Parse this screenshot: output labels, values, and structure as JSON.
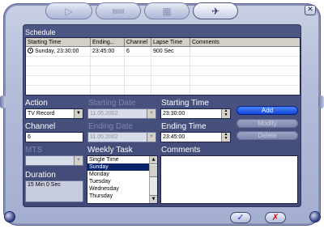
{
  "window": {
    "tabs": [
      {
        "name": "play-icon",
        "glyph": "▷"
      },
      {
        "name": "film-icon",
        "glyph": "▤▤"
      },
      {
        "name": "calendar-icon",
        "glyph": "▦"
      },
      {
        "name": "satellite-icon",
        "glyph": "✈"
      }
    ],
    "close_glyph": "✕"
  },
  "schedule": {
    "label": "Schedule",
    "columns": [
      "Starting Time",
      "Ending...",
      "Channel",
      "Lapse Time",
      "Comments"
    ],
    "rows": [
      {
        "start": "Sunday, 23:30:00",
        "end": "23:45:00",
        "channel": "6",
        "lapse": "900 Sec",
        "comments": ""
      }
    ]
  },
  "form": {
    "action": {
      "label": "Action",
      "value": "TV Record"
    },
    "starting_date": {
      "label": "Starting Date",
      "value": "11.05.2002"
    },
    "starting_time": {
      "label": "Starting Time",
      "value": "23:30:00"
    },
    "channel": {
      "label": "Channel",
      "value": "6"
    },
    "ending_date": {
      "label": "Ending Date",
      "value": "11.05.2002"
    },
    "ending_time": {
      "label": "Ending Time",
      "value": "23:45:00"
    },
    "mts": {
      "label": "MTS",
      "value": ""
    },
    "weekly_task": {
      "label": "Weekly Task",
      "options": [
        "Single Time",
        "Sunday",
        "Monday",
        "Tuesday",
        "Wednesday",
        "Thursday"
      ],
      "selected_index": 1
    },
    "comments": {
      "label": "Comments",
      "value": ""
    },
    "duration": {
      "label": "Duration",
      "value": "15 Min 0 Sec"
    }
  },
  "buttons": {
    "add": "Add",
    "modify": "Modify",
    "delete": "Delete",
    "ok_glyph": "✓",
    "cancel_glyph": "✗"
  },
  "colors": {
    "accent": "#0c3fd6",
    "panel": "#4c5683",
    "selection": "#0a246a"
  }
}
